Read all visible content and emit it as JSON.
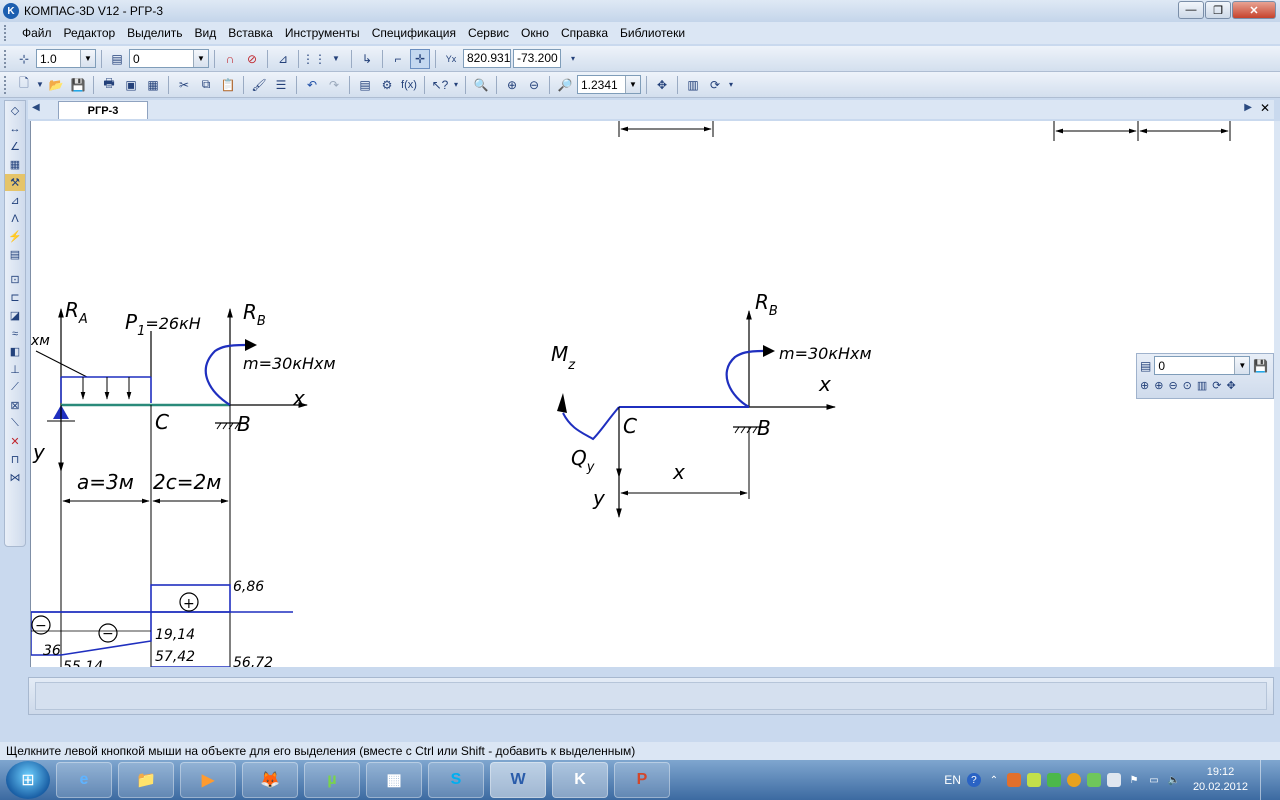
{
  "window": {
    "title": "КОМПАС-3D V12 - РГР-3",
    "app_icon": "K",
    "buttons": {
      "minimize": "—",
      "maximize": "❐",
      "close": "✕"
    }
  },
  "menu": [
    "Файл",
    "Редактор",
    "Выделить",
    "Вид",
    "Вставка",
    "Инструменты",
    "Спецификация",
    "Сервис",
    "Окно",
    "Справка",
    "Библиотеки"
  ],
  "toolbar1": {
    "step_value": "1.0",
    "layer_value": "0",
    "coord_x": "820.931",
    "coord_y": "-73.200"
  },
  "toolbar2": {
    "zoom_value": "1.2341"
  },
  "tabs": {
    "active": "РГР-3"
  },
  "floating_panel": {
    "layer_value": "0"
  },
  "drawing": {
    "left": {
      "RA": "R",
      "RA_sub": "A",
      "P1": "P",
      "P1_sub": "1",
      "P1_rest": "=26кН",
      "RB": "R",
      "RB_sub": "B",
      "partial": "хм",
      "m": "m=30кНхм",
      "x": "x",
      "y": "y",
      "C": "C",
      "B": "B",
      "a": "a=3м",
      "c": "2c=2м",
      "d_686": "6,86",
      "d_1914": "19,14",
      "d_5742": "57,42",
      "d_36": "36",
      "d_5514": "55,14",
      "d_5672": "56,72",
      "plus": "+",
      "minus": "−"
    },
    "right": {
      "RB": "R",
      "RB_sub": "B",
      "m": "m=30кНхм",
      "Mz": "M",
      "Mz_sub": "z",
      "x": "x",
      "C": "C",
      "B": "B",
      "Qy": "Q",
      "Qy_sub": "y",
      "x_dim": "x",
      "y": "y"
    }
  },
  "status_text": "Щелкните левой кнопкой мыши на объекте для его выделения (вместе с Ctrl или Shift - добавить к выделенным)",
  "taskbar": {
    "apps": [
      "e",
      "📁",
      "▶",
      "🦊",
      "µ",
      "▦",
      "S",
      "W",
      "K",
      "P"
    ],
    "lang": "EN",
    "time": "19:12",
    "date": "20.02.2012"
  }
}
